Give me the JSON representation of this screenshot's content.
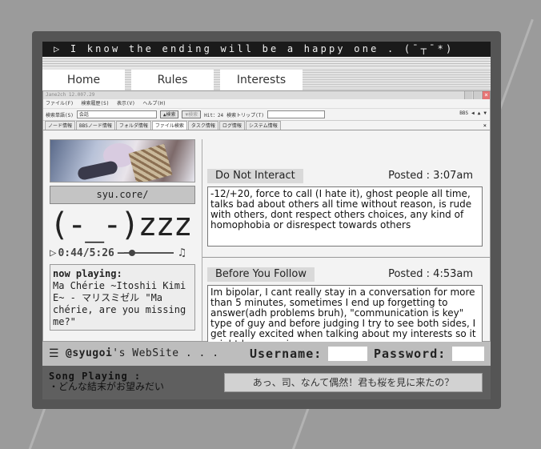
{
  "marquee": {
    "text": "▷ I know the ending will be a happy one . (¯┬¯*)"
  },
  "tabs": [
    {
      "label": "Home"
    },
    {
      "label": "Rules"
    },
    {
      "label": "Interests"
    }
  ],
  "app": {
    "title": "Jane2ch 12.007.29",
    "menu": [
      "ファイル(F)",
      "検索履歴(S)",
      "表示(V)",
      "ヘルプ(H)"
    ],
    "toolbar": {
      "search_label": "検索単語(S)",
      "search_value": "会話",
      "search_button": "▲検索",
      "search_button2": "▼検索",
      "hit": "Hit：24",
      "tripcode_label": "検索トリップ(T)",
      "bbs": "BBS"
    },
    "subtabs": [
      "ノード情報",
      "BBSノード情報",
      "フォルダ情報",
      "ファイル検索",
      "タスク情報",
      "ログ情報",
      "システム情報"
    ],
    "subtab_close": "×"
  },
  "profile": {
    "link": "syu.core/",
    "kaomoji": "(-_-)zzz",
    "player_time": "0:44/5:26",
    "now_playing_title": "now playing:",
    "now_playing_text": "Ma Chérie ~Itoshii Kimi E~ - マリスミゼル \"Ma chérie, are you missing me?\""
  },
  "posts": [
    {
      "label": "Do Not Interact",
      "time": "Posted : 3:07am",
      "body": "-12/+20, force to call (I hate it), ghost people all time, talks bad about others all time without reason, is rude with others, dont respect others choices, any kind of homophobia or disrespect towards others"
    },
    {
      "label": "Before You Follow",
      "time": "Posted : 4:53am",
      "body": "Im bipolar, I cant really stay in a conversation for more than 5 minutes, sometimes I end up forgetting to answer(adh problems bruh), \"communication is key\" type of guy and before judging I try to see both sides, I get really excited when talking about my interests so it might be annoying"
    }
  ],
  "footer": {
    "menu_icon": "☰",
    "handle": "@syugoi",
    "site_suffix": "'s WebSite . . .",
    "username_label": "Username:",
    "password_label": "Password:"
  },
  "bottom": {
    "song_title": "Song Playing :",
    "song_text": "・どんな結末がお望みだい",
    "quote": "あっ、司、なんて偶然！君も桜を見に来たの？"
  }
}
